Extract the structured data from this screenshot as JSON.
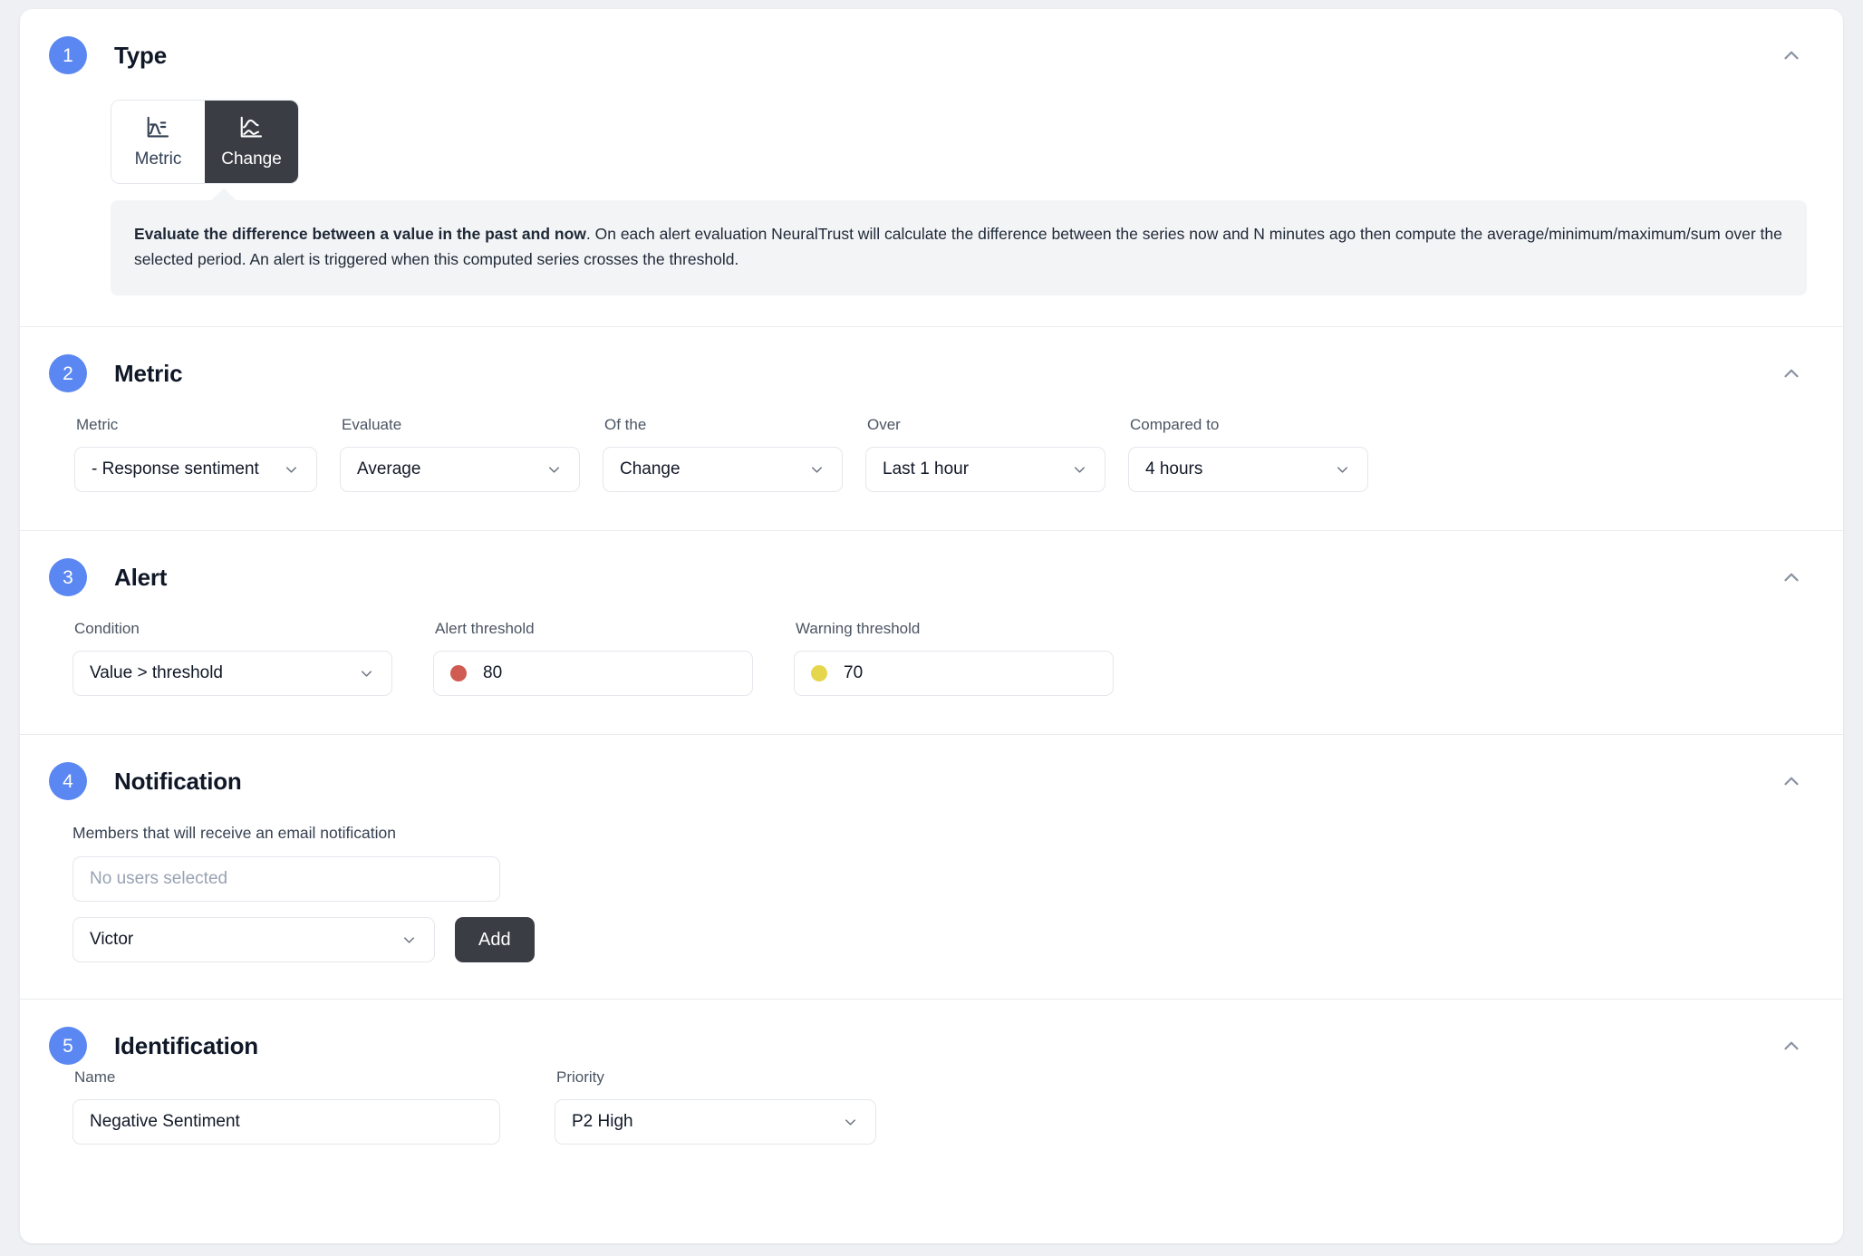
{
  "theme": {
    "badge_color": "#5b87f2",
    "active_toggle_bg": "#3b3d44",
    "alert_dot_color": "#cf5b53",
    "warning_dot_color": "#e6d64e",
    "callout_bg": "#f3f4f6",
    "page_bg": "#eef0f3"
  },
  "sections": {
    "type": {
      "number": "1",
      "title": "Type",
      "toggle": {
        "metric_label": "Metric",
        "change_label": "Change",
        "selected": "Change"
      },
      "callout": {
        "bold": "Evaluate the difference between a value in the past and now",
        "rest": ". On each alert evaluation NeuralTrust will calculate the difference between the series now and N minutes ago then compute the average/minimum/maximum/sum over the selected period. An alert is triggered when this computed series crosses the threshold."
      }
    },
    "metric": {
      "number": "2",
      "title": "Metric",
      "fields": {
        "metric": {
          "label": "Metric",
          "value": "- Response sentiment"
        },
        "evaluate": {
          "label": "Evaluate",
          "value": "Average"
        },
        "of_the": {
          "label": "Of the",
          "value": "Change"
        },
        "over": {
          "label": "Over",
          "value": "Last 1 hour"
        },
        "compared_to": {
          "label": "Compared to",
          "value": "4 hours"
        }
      }
    },
    "alert": {
      "number": "3",
      "title": "Alert",
      "fields": {
        "condition": {
          "label": "Condition",
          "value": "Value > threshold"
        },
        "alert_threshold": {
          "label": "Alert threshold",
          "value": "80"
        },
        "warning_threshold": {
          "label": "Warning threshold",
          "value": "70"
        }
      }
    },
    "notification": {
      "number": "4",
      "title": "Notification",
      "members_label": "Members that will receive an email notification",
      "members_placeholder": "No users selected",
      "user_select_value": "Victor",
      "add_label": "Add"
    },
    "identification": {
      "number": "5",
      "title": "Identification",
      "fields": {
        "name": {
          "label": "Name",
          "value": "Negative Sentiment"
        },
        "priority": {
          "label": "Priority",
          "value": "P2 High"
        }
      }
    }
  },
  "icons": {
    "collapse": "chevron-up-icon",
    "dropdown": "chevron-down-icon",
    "metric_icon": "line-chart-icon",
    "change_icon": "change-chart-icon"
  }
}
